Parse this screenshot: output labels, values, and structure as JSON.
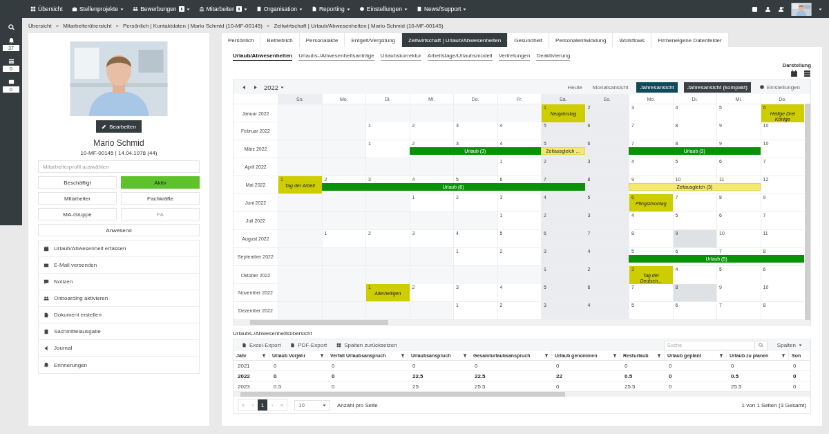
{
  "topbar": {
    "menu": [
      {
        "label": "Übersicht",
        "dropdown": false,
        "badge": false
      },
      {
        "label": "Stellenprojekte",
        "dropdown": true,
        "badge": false
      },
      {
        "label": "Bewerbungen",
        "dropdown": true,
        "badge": true
      },
      {
        "label": "Mitarbeiter",
        "dropdown": true,
        "badge": true
      },
      {
        "label": "Organisation",
        "dropdown": true,
        "badge": false
      },
      {
        "label": "Reporting",
        "dropdown": true,
        "badge": false
      },
      {
        "label": "Einstellungen",
        "dropdown": true,
        "badge": false
      },
      {
        "label": "News/Support",
        "dropdown": true,
        "badge": false
      }
    ]
  },
  "rail": [
    {
      "count": "37"
    },
    {
      "count": "0"
    },
    {
      "count": "0"
    }
  ],
  "breadcrumb": [
    {
      "label": "Übersicht"
    },
    {
      "label": "Mitarbeiterübersicht"
    },
    {
      "label": "Persönlich | Kontaktdaten | Mario Schmid (10-MF-00145)"
    },
    {
      "label": "Zeitwirtschaft | Urlaub/Abwesenheiten | Mario Schmid (10-MF-00145)"
    }
  ],
  "breadcrumb_separator": "»",
  "profile": {
    "edit_button": "Bearbeiten",
    "name": "Mario Schmid",
    "details": "10-MF-00145 | 14.04.1978 (44)",
    "profile_select": {
      "placeholder": "Mitarbeiterprofil auswählen"
    },
    "status": [
      {
        "label": "Beschäftigt",
        "kind": "plain"
      },
      {
        "label": "Aktiv",
        "kind": "active"
      },
      {
        "label": "Mitarbeiter",
        "kind": "plain"
      },
      {
        "label": "Fachkräfte",
        "kind": "plain"
      },
      {
        "label": "MA-Gruppe",
        "kind": "plain"
      },
      {
        "label": "FA",
        "kind": "muted"
      },
      {
        "label": "Anwesend",
        "kind": "wide"
      }
    ],
    "actions": [
      {
        "label": "Urlaub/Abwesenheit erfassen"
      },
      {
        "label": "E-Mail versenden"
      },
      {
        "label": "Notizen"
      },
      {
        "label": "Onboarding aktivieren"
      },
      {
        "label": "Dokument erstellen"
      },
      {
        "label": "Sachmittelausgabe"
      },
      {
        "label": "Journal"
      },
      {
        "label": "Erinnerungen"
      }
    ]
  },
  "tabs": [
    {
      "label": "Persönlich",
      "selected": false
    },
    {
      "label": "Betrieblich",
      "selected": false
    },
    {
      "label": "Personalakte",
      "selected": false
    },
    {
      "label": "Entgelt/Vergütung",
      "selected": false
    },
    {
      "label": "Zeitwirtschaft | Urlaub/Abwesenheiten",
      "selected": true
    },
    {
      "label": "Gesundheit",
      "selected": false
    },
    {
      "label": "Personalentwicklung",
      "selected": false
    },
    {
      "label": "Workflows",
      "selected": false
    },
    {
      "label": "Firmeneigene Datenfelder",
      "selected": false
    }
  ],
  "subtabs": [
    {
      "label": "Urlaub/Abwesenheiten",
      "selected": true
    },
    {
      "label": "Urlaubs-/Abwesenheitsanträge",
      "selected": false
    },
    {
      "label": "Urlaubskorrektur",
      "selected": false
    },
    {
      "label": "Arbeitstage/Urlaubsmodell",
      "selected": false
    },
    {
      "label": "Vertretungen",
      "selected": false
    },
    {
      "label": "Deaktivierung",
      "selected": false
    }
  ],
  "display": {
    "label": "Darstellung"
  },
  "calendar": {
    "year": "2022",
    "views": [
      {
        "label": "Heute",
        "kind": "text",
        "selected": false
      },
      {
        "label": "Monatsansicht",
        "kind": "text",
        "selected": false
      },
      {
        "label": "Jahresansicht",
        "kind": "button",
        "selected": true
      },
      {
        "label": "Jahresansicht (kompakt)",
        "kind": "button",
        "selected": false
      }
    ],
    "settings": "Einstellungen",
    "weekdays": [
      {
        "label": "So.",
        "weekend": true
      },
      {
        "label": "Mo.",
        "weekend": false
      },
      {
        "label": "Di.",
        "weekend": false
      },
      {
        "label": "Mi.",
        "weekend": false
      },
      {
        "label": "Do.",
        "weekend": false
      },
      {
        "label": "Fr.",
        "weekend": false
      },
      {
        "label": "Sa.",
        "weekend": true
      },
      {
        "label": "So.",
        "weekend": true
      },
      {
        "label": "Mo.",
        "weekend": false
      },
      {
        "label": "Di.",
        "weekend": false
      },
      {
        "label": "Mi.",
        "weekend": false
      },
      {
        "label": "Do.",
        "weekend": false
      }
    ],
    "months": [
      {
        "label": "Januar 2022",
        "cells": [
          null,
          null,
          null,
          null,
          null,
          null,
          {
            "day": "1",
            "holiday": "Neujahrstag"
          },
          {
            "day": "2"
          },
          {
            "day": "3"
          },
          {
            "day": "4"
          },
          {
            "day": "5"
          },
          {
            "day": "6",
            "holiday": "Heilige Drei Könige"
          }
        ]
      },
      {
        "label": "Februar 2022",
        "cells": [
          null,
          null,
          {
            "day": "1"
          },
          {
            "day": "2"
          },
          {
            "day": "3"
          },
          {
            "day": "4"
          },
          {
            "day": "5"
          },
          {
            "day": "6"
          },
          {
            "day": "7"
          },
          {
            "day": "8"
          },
          {
            "day": "9"
          },
          {
            "day": "10"
          }
        ]
      },
      {
        "label": "März 2022",
        "cells": [
          null,
          null,
          {
            "day": "1"
          },
          {
            "day": "2",
            "bar": {
              "kind": "vacation",
              "label": "Urlaub (3)"
            }
          },
          {
            "day": "3",
            "bar": {
              "kind": "vacation"
            }
          },
          {
            "day": "4",
            "bar": {
              "kind": "vacation"
            }
          },
          {
            "day": "5",
            "bar": {
              "kind": "comp",
              "label": "Zeitausgleich ..."
            }
          },
          {
            "day": "6"
          },
          {
            "day": "7",
            "bar": {
              "kind": "vacation",
              "label": "Urlaub (3)"
            }
          },
          {
            "day": "8",
            "bar": {
              "kind": "vacation"
            }
          },
          {
            "day": "9",
            "bar": {
              "kind": "vacation"
            }
          },
          {
            "day": "10"
          }
        ]
      },
      {
        "label": "April 2022",
        "cells": [
          null,
          null,
          null,
          null,
          null,
          {
            "day": "1"
          },
          {
            "day": "2"
          },
          {
            "day": "3"
          },
          {
            "day": "4"
          },
          {
            "day": "5"
          },
          {
            "day": "6"
          },
          {
            "day": "7"
          }
        ]
      },
      {
        "label": "Mai 2022",
        "cells": [
          {
            "day": "1",
            "holiday": "Tag der Arbeit"
          },
          {
            "day": "2",
            "bar": {
              "kind": "vacation",
              "label": "Urlaub (6)"
            }
          },
          {
            "day": "3",
            "bar": {
              "kind": "vacation"
            }
          },
          {
            "day": "4",
            "bar": {
              "kind": "vacation"
            }
          },
          {
            "day": "5",
            "bar": {
              "kind": "vacation"
            }
          },
          {
            "day": "6",
            "bar": {
              "kind": "vacation"
            }
          },
          {
            "day": "7",
            "bar": {
              "kind": "vacation"
            }
          },
          {
            "day": "8"
          },
          {
            "day": "9",
            "bar": {
              "kind": "comp",
              "label": "Zeitausgleich (3)"
            }
          },
          {
            "day": "10",
            "bar": {
              "kind": "comp"
            }
          },
          {
            "day": "11",
            "bar": {
              "kind": "comp"
            }
          },
          {
            "day": "12"
          }
        ]
      },
      {
        "label": "Juni 2022",
        "cells": [
          null,
          null,
          null,
          {
            "day": "1"
          },
          {
            "day": "2"
          },
          {
            "day": "3"
          },
          {
            "day": "4"
          },
          {
            "day": "5"
          },
          {
            "day": "6",
            "holiday": "Pfingstmontag"
          },
          {
            "day": "7"
          },
          {
            "day": "8"
          },
          {
            "day": "9"
          }
        ]
      },
      {
        "label": "Juli 2022",
        "cells": [
          null,
          null,
          null,
          null,
          null,
          {
            "day": "1"
          },
          {
            "day": "2"
          },
          {
            "day": "3"
          },
          {
            "day": "4"
          },
          {
            "day": "5"
          },
          {
            "day": "6"
          },
          {
            "day": "7"
          }
        ]
      },
      {
        "label": "August 2022",
        "cells": [
          null,
          {
            "day": "1"
          },
          {
            "day": "2"
          },
          {
            "day": "3"
          },
          {
            "day": "4"
          },
          {
            "day": "5"
          },
          {
            "day": "6"
          },
          {
            "day": "7"
          },
          {
            "day": "8"
          },
          {
            "day": "9",
            "marked": true
          },
          {
            "day": "10"
          },
          {
            "day": "11"
          }
        ]
      },
      {
        "label": "September 2022",
        "cells": [
          null,
          null,
          null,
          null,
          {
            "day": "1"
          },
          {
            "day": "2"
          },
          {
            "day": "3"
          },
          {
            "day": "4"
          },
          {
            "day": "5",
            "bar": {
              "kind": "vacation",
              "label": "Urlaub (5)"
            }
          },
          {
            "day": "6",
            "bar": {
              "kind": "vacation"
            }
          },
          {
            "day": "7",
            "bar": {
              "kind": "vacation"
            }
          },
          {
            "day": "8",
            "bar": {
              "kind": "vacation"
            }
          }
        ]
      },
      {
        "label": "Oktober 2022",
        "cells": [
          null,
          null,
          null,
          null,
          null,
          null,
          {
            "day": "1"
          },
          {
            "day": "2"
          },
          {
            "day": "3",
            "holiday": "Tag der Deutsch..."
          },
          {
            "day": "4"
          },
          {
            "day": "5"
          },
          {
            "day": "6"
          }
        ]
      },
      {
        "label": "November 2022",
        "cells": [
          null,
          null,
          {
            "day": "1",
            "holiday": "Allerheiligen"
          },
          {
            "day": "2"
          },
          {
            "day": "3"
          },
          {
            "day": "4"
          },
          {
            "day": "5"
          },
          {
            "day": "6"
          },
          {
            "day": "7"
          },
          {
            "day": "8",
            "marked": true
          },
          {
            "day": "9"
          },
          {
            "day": "10"
          }
        ]
      },
      {
        "label": "Dezember 2022",
        "cells": [
          null,
          null,
          null,
          null,
          {
            "day": "1"
          },
          {
            "day": "2"
          },
          {
            "day": "3"
          },
          {
            "day": "4"
          },
          {
            "day": "5"
          },
          {
            "day": "6"
          },
          {
            "day": "7"
          },
          {
            "day": "8"
          }
        ]
      }
    ]
  },
  "overview": {
    "title": "Urlaubs-/Abwesenheitsübersicht",
    "toolbar": [
      {
        "label": "Excel-Export"
      },
      {
        "label": "PDF-Export"
      },
      {
        "label": "Spalten zurücksetzen"
      }
    ],
    "search": {
      "placeholder": "Suche"
    },
    "columns_button": "Spalten",
    "columns": [
      {
        "label": "Jahr",
        "filter": true
      },
      {
        "label": "Urlaub Vorjahr",
        "filter": true
      },
      {
        "label": "Verfall Urlaubsanspruch",
        "filter": true
      },
      {
        "label": "Urlaubsanspruch",
        "filter": true
      },
      {
        "label": "Gesamturlaubsanspruch",
        "filter": true
      },
      {
        "label": "Urlaub genommen",
        "filter": true
      },
      {
        "label": "Resturlaub",
        "filter": true
      },
      {
        "label": "Urlaub geplant",
        "filter": true
      },
      {
        "label": "Urlaub zu planen",
        "filter": true
      },
      {
        "label": "Son",
        "filter": false
      }
    ],
    "rows": [
      {
        "emphasized": false,
        "cells": [
          "2021",
          "0",
          "0",
          "0",
          "0",
          "0",
          "0",
          "0",
          "0",
          "0"
        ]
      },
      {
        "emphasized": true,
        "cells": [
          "2022",
          "0",
          "0",
          "22.5",
          "22.5",
          "22",
          "0.5",
          "0",
          "0.5",
          "0"
        ]
      },
      {
        "emphasized": false,
        "cells": [
          "2023",
          "0.5",
          "0",
          "25",
          "25.5",
          "0",
          "25.5",
          "0",
          "25.5",
          "0"
        ]
      }
    ],
    "pager": [
      {
        "label": "«",
        "selected": false,
        "disabled": true
      },
      {
        "label": "‹",
        "selected": false,
        "disabled": true
      },
      {
        "label": "1",
        "selected": true,
        "disabled": false
      },
      {
        "label": "›",
        "selected": false,
        "disabled": true
      },
      {
        "label": "»",
        "selected": false,
        "disabled": true
      }
    ],
    "page_size": "10",
    "page_size_label": "Anzahl pro Seite",
    "summary": "1 von 1 Seiten (3 Gesamt)"
  }
}
